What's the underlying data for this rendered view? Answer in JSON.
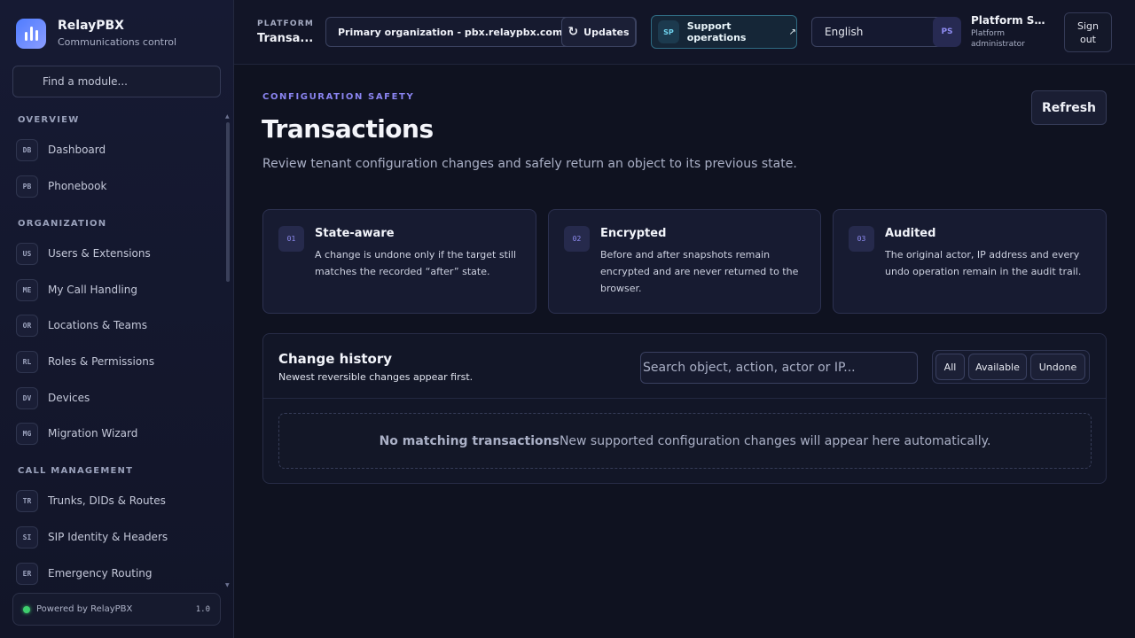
{
  "brand": {
    "name": "RelayPBX",
    "subtitle": "Communications control"
  },
  "sidebar": {
    "search_placeholder": "Find a module...",
    "sections": [
      {
        "title": "OVERVIEW",
        "items": [
          {
            "code": "DB",
            "label": "Dashboard"
          },
          {
            "code": "PB",
            "label": "Phonebook"
          }
        ]
      },
      {
        "title": "ORGANIZATION",
        "items": [
          {
            "code": "US",
            "label": "Users & Extensions"
          },
          {
            "code": "ME",
            "label": "My Call Handling"
          },
          {
            "code": "OR",
            "label": "Locations & Teams"
          },
          {
            "code": "RL",
            "label": "Roles & Permissions"
          },
          {
            "code": "DV",
            "label": "Devices"
          },
          {
            "code": "MG",
            "label": "Migration Wizard"
          }
        ]
      },
      {
        "title": "CALL MANAGEMENT",
        "items": [
          {
            "code": "TR",
            "label": "Trunks, DIDs & Routes"
          },
          {
            "code": "SI",
            "label": "SIP Identity & Headers"
          },
          {
            "code": "ER",
            "label": "Emergency Routing"
          }
        ]
      }
    ],
    "footer": {
      "label": "Powered by RelayPBX",
      "version": "1.0",
      "status_color": "#3ecf6e"
    }
  },
  "header": {
    "platform_kicker": "PLATFORM",
    "platform_title": "Transa...",
    "org_selector": "Primary organization - pbx.relaypbx.com",
    "updates_label": "Updates",
    "support": {
      "chip": "SP",
      "label": "Support operations"
    },
    "language": "English",
    "user": {
      "initials": "PS",
      "name": "Platform Su...",
      "role": "Platform administrator"
    },
    "signout_label": "Sign out"
  },
  "main": {
    "kicker": "CONFIGURATION SAFETY",
    "title": "Transactions",
    "description": "Review tenant configuration changes and safely return an object to its previous state.",
    "refresh_label": "Refresh",
    "features": [
      {
        "num": "01",
        "title": "State-aware",
        "text": "A change is undone only if the target still matches the recorded “after” state."
      },
      {
        "num": "02",
        "title": "Encrypted",
        "text": "Before and after snapshots remain encrypted and are never returned to the browser."
      },
      {
        "num": "03",
        "title": "Audited",
        "text": "The original actor, IP address and every undo operation remain in the audit trail."
      }
    ],
    "history": {
      "title": "Change history",
      "subtitle": "Newest reversible changes appear first.",
      "search_placeholder": "Search object, action, actor or IP...",
      "filters": [
        "All",
        "Available",
        "Undone"
      ],
      "empty_title": "No matching transactions",
      "empty_text": "New supported configuration changes will appear here automatically."
    }
  },
  "colors": {
    "accent": "#8a84f0",
    "brand": "#4f7cff",
    "support": "#6fd3ee"
  }
}
